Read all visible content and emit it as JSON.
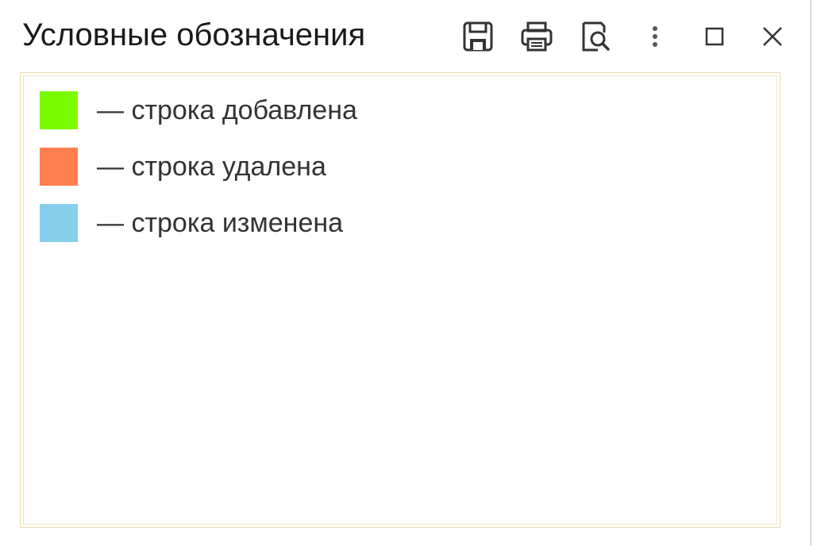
{
  "window": {
    "title": "Условные обозначения"
  },
  "toolbar": {
    "buttons": [
      {
        "icon": "save-icon"
      },
      {
        "icon": "print-icon"
      },
      {
        "icon": "preview-icon"
      },
      {
        "icon": "more-icon"
      },
      {
        "icon": "maximize-icon"
      },
      {
        "icon": "close-icon"
      }
    ]
  },
  "legend": {
    "items": [
      {
        "label": "— строка добавлена",
        "color": "#7cfc00"
      },
      {
        "label": "— строка удалена",
        "color": "#ff7f50"
      },
      {
        "label": "— строка изменена",
        "color": "#87ceeb"
      }
    ]
  },
  "colors": {
    "content_border": "#eadba0",
    "text": "#333333"
  }
}
